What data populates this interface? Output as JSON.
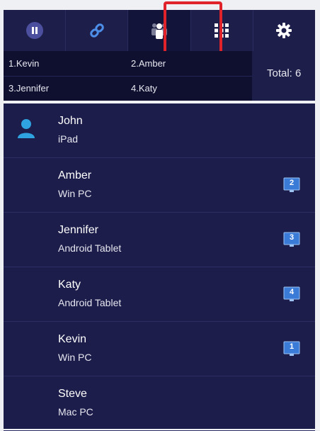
{
  "toolbar": {
    "buttons": [
      {
        "icon": "pause-icon"
      },
      {
        "icon": "link-icon"
      },
      {
        "icon": "users-icon"
      },
      {
        "icon": "grid-icon"
      },
      {
        "icon": "gear-icon"
      }
    ],
    "accent": "#3b7bd8",
    "highlight_color": "#e0232b"
  },
  "summary": {
    "assignments": [
      "1.Kevin",
      "2.Amber",
      "3.Jennifer",
      "4.Katy"
    ],
    "total": "Total: 6"
  },
  "participants": [
    {
      "name": "John",
      "device": "iPad",
      "host": true,
      "badge": ""
    },
    {
      "name": "Amber",
      "device": "Win PC",
      "host": false,
      "badge": "2"
    },
    {
      "name": "Jennifer",
      "device": "Android Tablet",
      "host": false,
      "badge": "3"
    },
    {
      "name": "Katy",
      "device": "Android Tablet",
      "host": false,
      "badge": "4"
    },
    {
      "name": "Kevin",
      "device": "Win PC",
      "host": false,
      "badge": "1"
    },
    {
      "name": "Steve",
      "device": "Mac PC",
      "host": false,
      "badge": ""
    }
  ]
}
